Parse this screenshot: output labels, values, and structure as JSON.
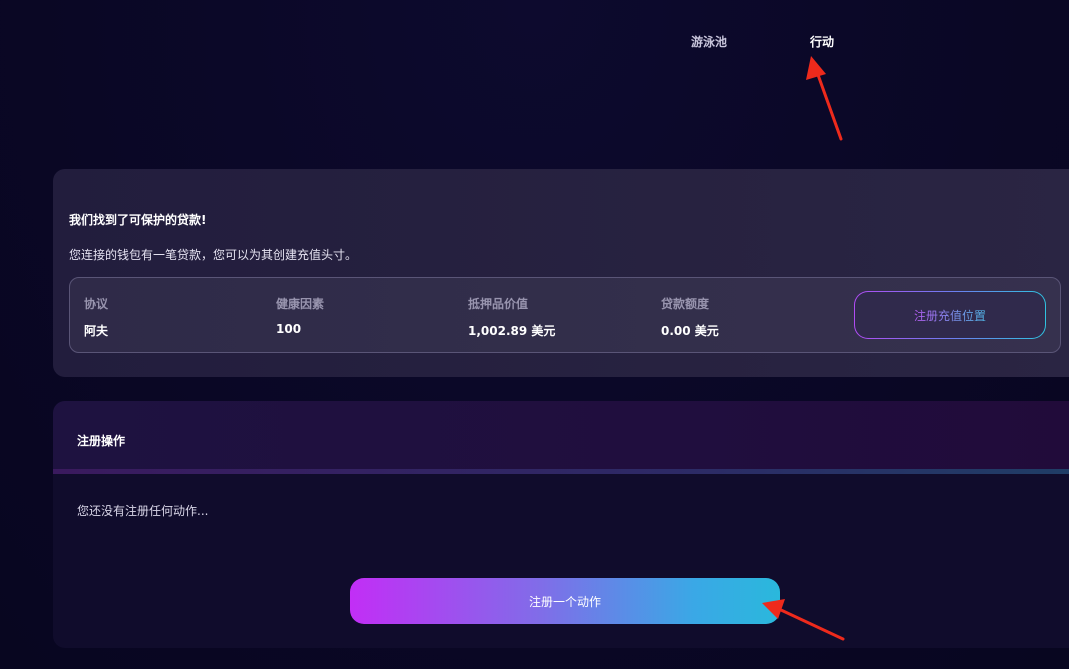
{
  "nav": {
    "pools_label": "游泳池",
    "actions_label": "行动"
  },
  "loan": {
    "title": "我们找到了可保护的贷款!",
    "description": "您连接的钱包有一笔贷款，您可以为其创建充值头寸。",
    "columns": [
      {
        "label": "协议",
        "value": "阿夫"
      },
      {
        "label": "健康因素",
        "value": "100"
      },
      {
        "label": "抵押品价值",
        "value": "1,002.89 美元"
      },
      {
        "label": "贷款额度",
        "value": "0.00 美元"
      }
    ],
    "register_position_label": "注册充值位置"
  },
  "actions": {
    "title": "注册操作",
    "empty_text": "您还没有注册任何动作...",
    "register_button_label": "注册一个动作"
  },
  "colors": {
    "background": "#0a0725",
    "annotation_arrow": "#ee2a1c",
    "accent_start": "#c22ef6",
    "accent_end": "#2ab8dc"
  },
  "icons": [
    "annotation-arrow-icon"
  ]
}
